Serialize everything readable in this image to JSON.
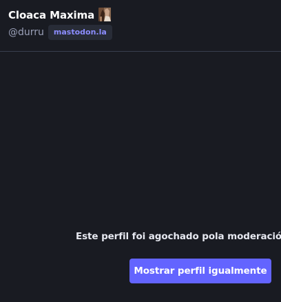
{
  "profile": {
    "display_name": "Cloaca Maxima",
    "emoji_icon": "custom-emoji-icon",
    "handle": "@durru",
    "domain": "mastodon.la"
  },
  "moderation": {
    "message": "Este perfil foi agochado pola moderación de",
    "button_label": "Mostrar perfil igualmente"
  },
  "colors": {
    "background": "#191b22",
    "divider": "#393f4f",
    "accent": "#6364ff",
    "badge_bg": "#282c37",
    "badge_text": "#8c8dff"
  }
}
